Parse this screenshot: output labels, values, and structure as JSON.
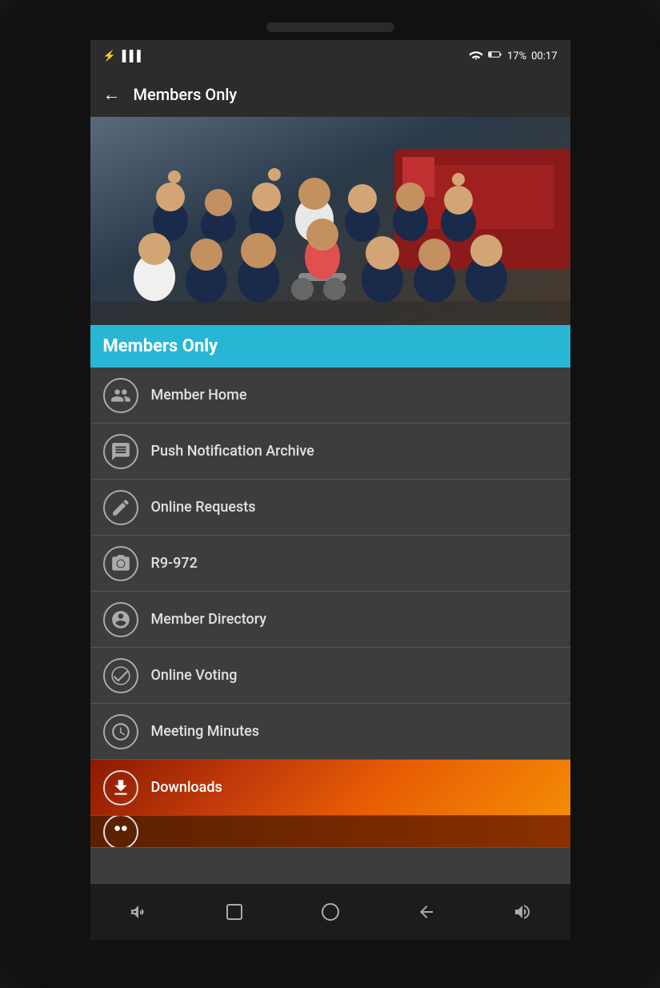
{
  "status_bar": {
    "left_icons": [
      "usb-icon",
      "bar-icon"
    ],
    "wifi_icon": "wifi-icon",
    "battery_icon": "battery-icon",
    "battery_level": "17%",
    "time": "00:17"
  },
  "top_bar": {
    "back_label": "←",
    "title": "Members Only"
  },
  "banner": {
    "text": "Members Only"
  },
  "menu_items": [
    {
      "id": "member-home",
      "label": "Member Home",
      "icon": "people-icon"
    },
    {
      "id": "push-notification-archive",
      "label": "Push Notification Archive",
      "icon": "message-icon"
    },
    {
      "id": "online-requests",
      "label": "Online Requests",
      "icon": "pencil-icon"
    },
    {
      "id": "r9-972",
      "label": "R9-972",
      "icon": "camera-icon"
    },
    {
      "id": "member-directory",
      "label": "Member Directory",
      "icon": "people2-icon"
    },
    {
      "id": "online-voting",
      "label": "Online Voting",
      "icon": "check-icon"
    },
    {
      "id": "meeting-minutes",
      "label": "Meeting Minutes",
      "icon": "clock-icon"
    },
    {
      "id": "downloads",
      "label": "Downloads",
      "icon": "download-icon",
      "special": "fire"
    }
  ],
  "bottom_nav": [
    {
      "id": "volume-down",
      "symbol": "🔈"
    },
    {
      "id": "recent-apps",
      "symbol": "⬜"
    },
    {
      "id": "home",
      "symbol": "⬡"
    },
    {
      "id": "back",
      "symbol": "↩"
    },
    {
      "id": "volume-up",
      "symbol": "🔊"
    }
  ]
}
